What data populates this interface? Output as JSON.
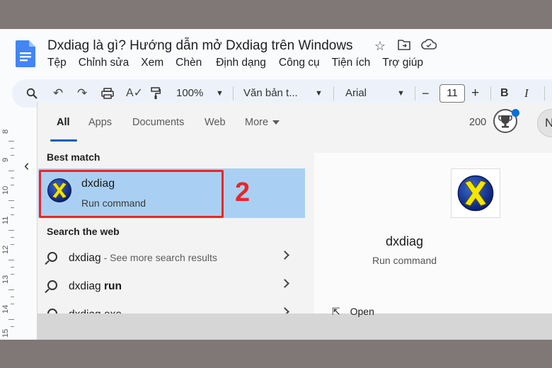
{
  "docs": {
    "title": "Dxdiag là gì? Hướng dẫn mở Dxdiag trên Windows",
    "menu": [
      "Tệp",
      "Chỉnh sửa",
      "Xem",
      "Chèn",
      "Định dạng",
      "Công cụ",
      "Tiện ích",
      "Trợ giúp"
    ],
    "toolbar": {
      "zoom": "100%",
      "style": "Văn bản t...",
      "font": "Arial",
      "font_size": "11",
      "minus": "−",
      "plus": "+",
      "bold": "B",
      "italic": "I"
    },
    "ruler_numbers": [
      "8",
      "9",
      "10",
      "11",
      "12",
      "13",
      "14",
      "15"
    ]
  },
  "search": {
    "tabs": [
      "All",
      "Apps",
      "Documents",
      "Web",
      "More"
    ],
    "active_tab": "All",
    "points": "200",
    "avatar_initial": "N",
    "best_match_heading": "Best match",
    "best_match": {
      "title": "dxdiag",
      "subtitle": "Run command"
    },
    "step_number": "2",
    "web_heading": "Search the web",
    "web_results": [
      {
        "query": "dxdiag",
        "hint": " - See more search results",
        "bold": ""
      },
      {
        "query": "dxdiag ",
        "hint": "",
        "bold": "run"
      },
      {
        "query": "dxdiag exe",
        "hint": "",
        "bold": ""
      }
    ],
    "preview": {
      "title": "dxdiag",
      "subtitle": "Run command",
      "open_label": "Open"
    }
  },
  "colors": {
    "accent_blue": "#005fb8",
    "selection": "#a9d0f2",
    "highlight_red": "#e8262a"
  }
}
